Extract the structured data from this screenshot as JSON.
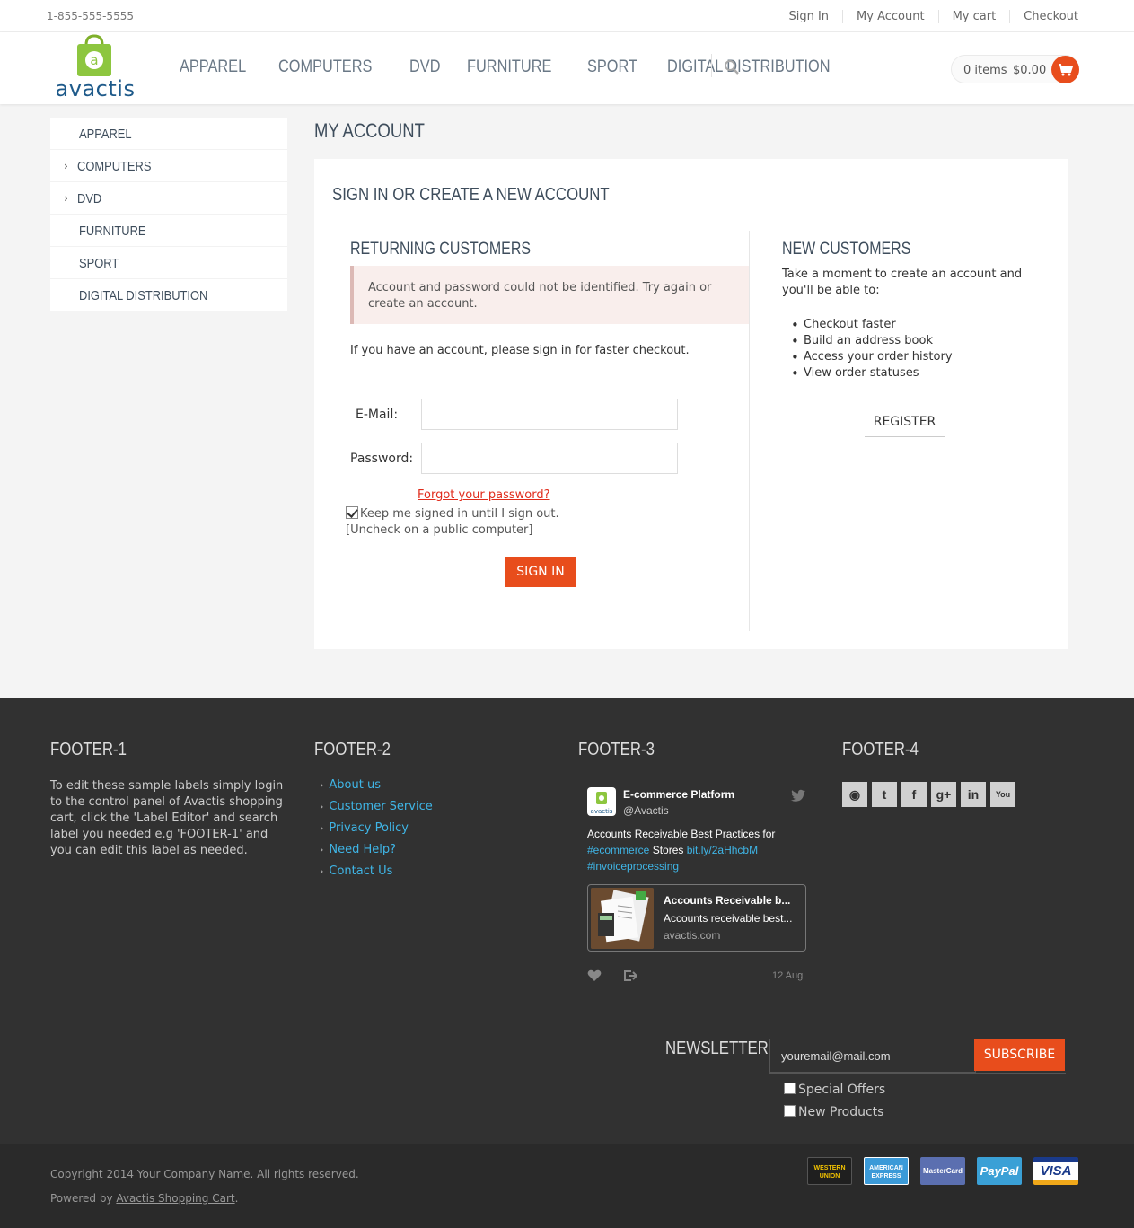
{
  "topbar": {
    "phone": "1-855-555-5555",
    "links": [
      "Sign In",
      "My Account",
      "My cart",
      "Checkout"
    ]
  },
  "header": {
    "logo_text": "avactis",
    "nav": [
      "APPAREL",
      "COMPUTERS",
      "DVD",
      "FURNITURE",
      "SPORT",
      "DIGITAL DISTRIBUTION"
    ],
    "cart_items": "0 items",
    "cart_total": "$0.00"
  },
  "sidebar": {
    "items": [
      {
        "label": "APPAREL",
        "chevron": false
      },
      {
        "label": "COMPUTERS",
        "chevron": true
      },
      {
        "label": "DVD",
        "chevron": true
      },
      {
        "label": "FURNITURE",
        "chevron": false
      },
      {
        "label": "SPORT",
        "chevron": false
      },
      {
        "label": "DIGITAL DISTRIBUTION",
        "chevron": false
      }
    ]
  },
  "main": {
    "page_title": "MY ACCOUNT",
    "panel_title": "SIGN IN OR CREATE A NEW ACCOUNT",
    "returning": {
      "title": "RETURNING CUSTOMERS",
      "alert": "Account and password could not be identified. Try again or create an account.",
      "info": "If you have an account, please sign in for faster checkout.",
      "email_label": "E-Mail:",
      "email_value": "",
      "password_label": "Password:",
      "password_value": "",
      "forgot": "Forgot your password?",
      "keep_signed": "Keep me signed in until I sign out.",
      "keep_note": "[Uncheck on a public computer]",
      "keep_checked": true,
      "signin_button": "SIGN IN"
    },
    "new_customers": {
      "title": "NEW CUSTOMERS",
      "text": "Take a moment to create an account and you'll be able to:",
      "bullets": [
        "Checkout faster",
        "Build an address book",
        "Access your order history",
        "View order statuses"
      ],
      "register_button": "REGISTER"
    }
  },
  "footer": {
    "col1": {
      "title": "FOOTER-1",
      "text": "To edit these sample labels simply login to the control panel of Avactis shopping cart, click the 'Label Editor' and search label you needed e.g 'FOOTER-1' and you can edit this label as needed."
    },
    "col2": {
      "title": "FOOTER-2",
      "links": [
        "About us",
        "Customer Service",
        "Privacy Policy",
        "Need Help?",
        "Contact Us"
      ]
    },
    "col3": {
      "title": "FOOTER-3",
      "tweet": {
        "name": "E-commerce Platform",
        "handle": "@Avactis",
        "avatar_text": "avactis",
        "text_1": "Accounts Receivable Best Practices for",
        "hashtag_1": "#ecommerce",
        "text_2": " Stores ",
        "link": "bit.ly/2aHhcbM",
        "hashtag_2": "#invoiceprocessing",
        "card_title": "Accounts Receivable b...",
        "card_desc": "Accounts receivable best...",
        "card_url": "avactis.com",
        "date": "12 Aug"
      }
    },
    "col4": {
      "title": "FOOTER-4",
      "social_icons": [
        "rss-icon",
        "twitter-icon",
        "facebook-icon",
        "google-plus-icon",
        "linkedin-icon",
        "youtube-icon"
      ],
      "social_glyphs": [
        "◉",
        "t",
        "f",
        "g+",
        "in",
        "You"
      ]
    },
    "newsletter": {
      "title": "NEWSLETTER",
      "input_value": "youremail@mail.com",
      "button": "SUBSCRIBE",
      "options": [
        "Special Offers",
        "New Products"
      ]
    },
    "copyright": "Copyright 2014 Your Company Name. All rights reserved.",
    "powered_prefix": "Powered by ",
    "powered_link": "Avactis Shopping Cart",
    "powered_suffix": ".",
    "payments": [
      {
        "name": "WESTERN UNION",
        "label": "WESTERN UNION",
        "bg": "#1f1f1f",
        "fg": "#f2c200"
      },
      {
        "name": "AMERICAN EXPRESS",
        "label": "AMERICAN EXPRESS",
        "bg": "#3b9ad8",
        "fg": "#ffffff"
      },
      {
        "name": "MasterCard",
        "label": "MasterCard",
        "bg": "#5b6fb0",
        "fg": "#ffffff"
      },
      {
        "name": "PayPal",
        "label": "PayPal",
        "bg": "#3aa0d6",
        "fg": "#ffffff"
      },
      {
        "name": "VISA",
        "label": "VISA",
        "bg": "#ffffff",
        "fg": "#1a3a8a"
      }
    ]
  },
  "colors": {
    "accent": "#e84d1c",
    "link": "#3fb5e6",
    "footer_bg": "#313131"
  }
}
